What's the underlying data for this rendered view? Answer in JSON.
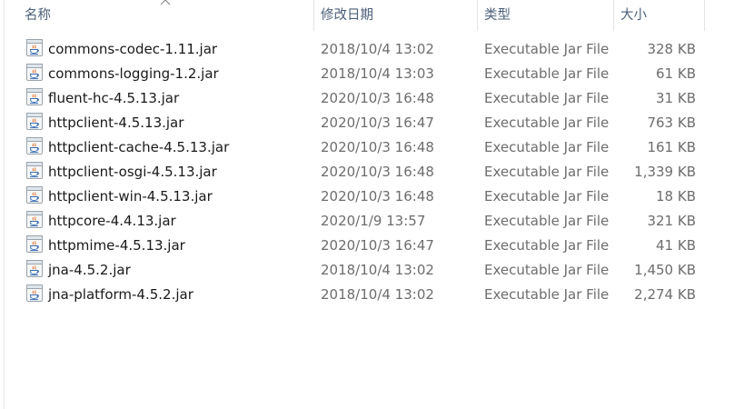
{
  "columns": {
    "name": "名称",
    "date": "修改日期",
    "type": "类型",
    "size": "大小"
  },
  "sort": {
    "column": "name",
    "direction": "ascending",
    "icon": "chevron-up-icon"
  },
  "files": [
    {
      "name": "commons-codec-1.11.jar",
      "date": "2018/10/4 13:02",
      "type": "Executable Jar File",
      "size": "328 KB",
      "icon": "java-jar-icon"
    },
    {
      "name": "commons-logging-1.2.jar",
      "date": "2018/10/4 13:03",
      "type": "Executable Jar File",
      "size": "61 KB",
      "icon": "java-jar-icon"
    },
    {
      "name": "fluent-hc-4.5.13.jar",
      "date": "2020/10/3 16:48",
      "type": "Executable Jar File",
      "size": "31 KB",
      "icon": "java-jar-icon"
    },
    {
      "name": "httpclient-4.5.13.jar",
      "date": "2020/10/3 16:47",
      "type": "Executable Jar File",
      "size": "763 KB",
      "icon": "java-jar-icon"
    },
    {
      "name": "httpclient-cache-4.5.13.jar",
      "date": "2020/10/3 16:48",
      "type": "Executable Jar File",
      "size": "161 KB",
      "icon": "java-jar-icon"
    },
    {
      "name": "httpclient-osgi-4.5.13.jar",
      "date": "2020/10/3 16:48",
      "type": "Executable Jar File",
      "size": "1,339 KB",
      "icon": "java-jar-icon"
    },
    {
      "name": "httpclient-win-4.5.13.jar",
      "date": "2020/10/3 16:48",
      "type": "Executable Jar File",
      "size": "18 KB",
      "icon": "java-jar-icon"
    },
    {
      "name": "httpcore-4.4.13.jar",
      "date": "2020/1/9 13:57",
      "type": "Executable Jar File",
      "size": "321 KB",
      "icon": "java-jar-icon"
    },
    {
      "name": "httpmime-4.5.13.jar",
      "date": "2020/10/3 16:47",
      "type": "Executable Jar File",
      "size": "41 KB",
      "icon": "java-jar-icon"
    },
    {
      "name": "jna-4.5.2.jar",
      "date": "2018/10/4 13:02",
      "type": "Executable Jar File",
      "size": "1,450 KB",
      "icon": "java-jar-icon"
    },
    {
      "name": "jna-platform-4.5.2.jar",
      "date": "2018/10/4 13:02",
      "type": "Executable Jar File",
      "size": "2,274 KB",
      "icon": "java-jar-icon"
    }
  ],
  "colors": {
    "header_text": "#4c607a",
    "detail_text": "#6d6d6d",
    "name_text": "#1a1a1a",
    "separator": "#e5e5e5"
  }
}
